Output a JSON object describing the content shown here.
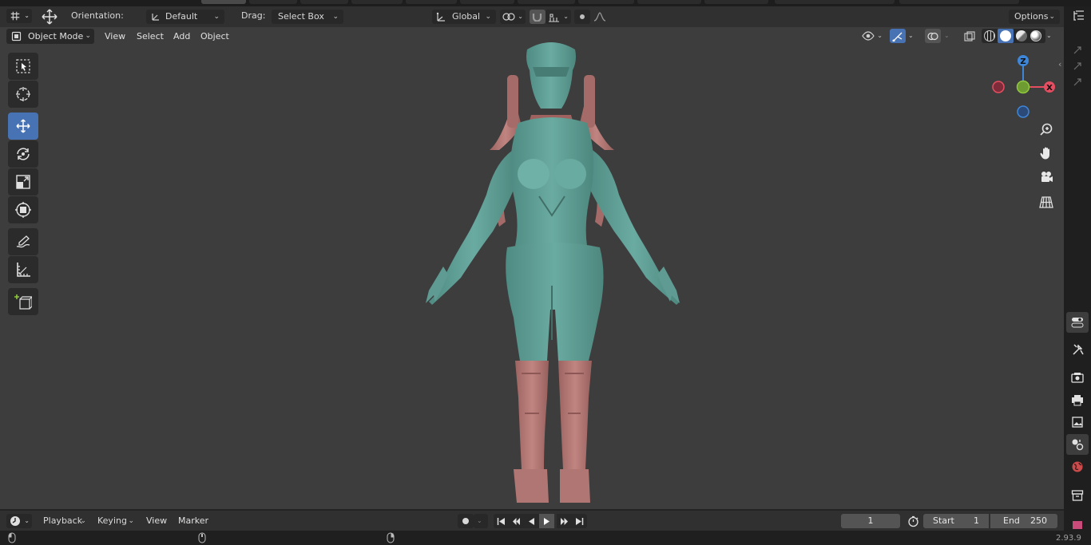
{
  "header": {
    "orientation_label": "Orientation:",
    "orientation_value": "Default",
    "drag_label": "Drag:",
    "drag_value": "Select Box",
    "transform_space": "Global",
    "options_label": "Options"
  },
  "viewport_header": {
    "mode": "Object Mode",
    "menus": [
      "View",
      "Select",
      "Add",
      "Object"
    ]
  },
  "gizmo": {
    "axes": [
      "Z",
      "X"
    ],
    "colors": {
      "x": "#e44e60",
      "y": "#8fc73d",
      "z": "#3e86d8"
    }
  },
  "toolbar": {
    "tools": [
      "select-box",
      "cursor",
      "move",
      "rotate",
      "scale",
      "transform",
      "annotate",
      "measure",
      "add-cube"
    ],
    "active_tool": "move"
  },
  "navigation": [
    "zoom",
    "pan",
    "camera",
    "grid"
  ],
  "timeline": {
    "menus": [
      "Playback",
      "Keying",
      "View",
      "Marker"
    ],
    "current_frame": "1",
    "start_label": "Start",
    "start_value": "1",
    "end_label": "End",
    "end_value": "250"
  },
  "status_bar": {
    "version": "2.93.9"
  },
  "colors": {
    "accent": "#4772b3",
    "viewport_bg": "#3d3d3d",
    "model_teal": "#5f9e94",
    "model_pink": "#b97b78"
  }
}
